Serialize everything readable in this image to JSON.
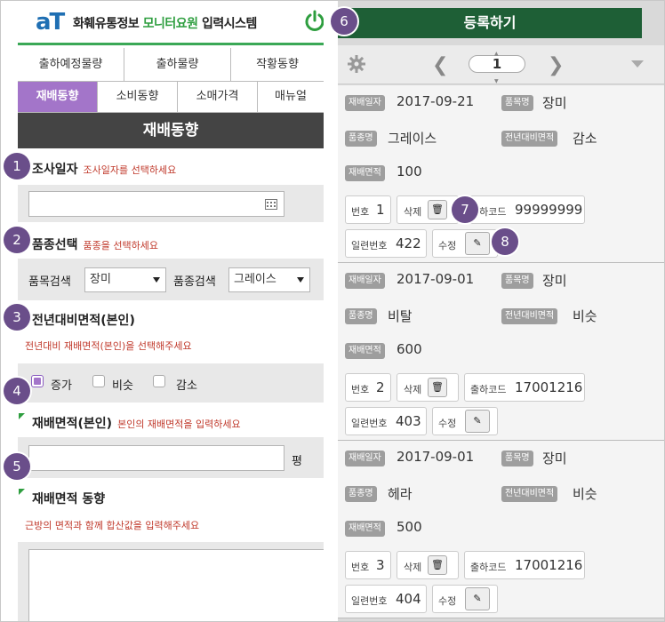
{
  "header": {
    "logo_mark": "aT",
    "logo_org": "화훼유통정보",
    "logo_product": "모니터요원",
    "logo_system": "입력시스템",
    "register_label": "등록하기"
  },
  "menu": {
    "row1": [
      "출하예정물량",
      "출하물량",
      "작황동향"
    ],
    "row2": [
      "재배동향",
      "소비동향",
      "소매가격",
      "매뉴얼"
    ],
    "active": "재배동향"
  },
  "section_title": "재배동향",
  "form": {
    "survey_date": {
      "label": "조사일자",
      "hint": "조사일자를 선택하세요",
      "value": ""
    },
    "variety": {
      "label": "품종선택",
      "hint": "품종을 선택하세요",
      "item_search_label": "품목검색",
      "item_value": "장미",
      "variety_search_label": "품종검색",
      "variety_value": "그레이스"
    },
    "area_change": {
      "label": "전년대비면적(본인)",
      "hint": "전년대비 재배면적(본인)을 선택해주세요",
      "options": [
        "증가",
        "비슷",
        "감소"
      ],
      "selected": "증가"
    },
    "area": {
      "label": "재배면적(본인)",
      "hint": "본인의 재배면적을 입력하세요",
      "unit": "평",
      "value": ""
    },
    "area_trend": {
      "label": "재배면적 동향",
      "hint": "근방의 면적과 함께 합산값을 입력해주세요",
      "value": ""
    }
  },
  "steps": [
    "1",
    "2",
    "3",
    "4",
    "5",
    "6",
    "7",
    "8"
  ],
  "pager": {
    "page": "1"
  },
  "field_labels": {
    "date": "재배일자",
    "item": "품목명",
    "variety": "품종명",
    "change": "전년대비면적",
    "area": "재배면적",
    "no": "번호",
    "delete": "삭제",
    "barcode": "출하코드",
    "serial": "일련번호",
    "edit": "수정"
  },
  "records": [
    {
      "date": "2017-09-21",
      "item": "장미",
      "variety": "그레이스",
      "change": "감소",
      "area": "100",
      "no": "1",
      "barcode": "99999999",
      "serial": "422"
    },
    {
      "date": "2017-09-01",
      "item": "장미",
      "variety": "비탈",
      "change": "비슷",
      "area": "600",
      "no": "2",
      "barcode": "17001216",
      "serial": "403"
    },
    {
      "date": "2017-09-01",
      "item": "장미",
      "variety": "헤라",
      "change": "비슷",
      "area": "500",
      "no": "3",
      "barcode": "17001216",
      "serial": "404"
    }
  ],
  "colors": {
    "accent_purple": "#a375c9",
    "brand_green": "#2e9e3f",
    "register_bar": "#1e5f36",
    "hint_red": "#c0392b"
  }
}
